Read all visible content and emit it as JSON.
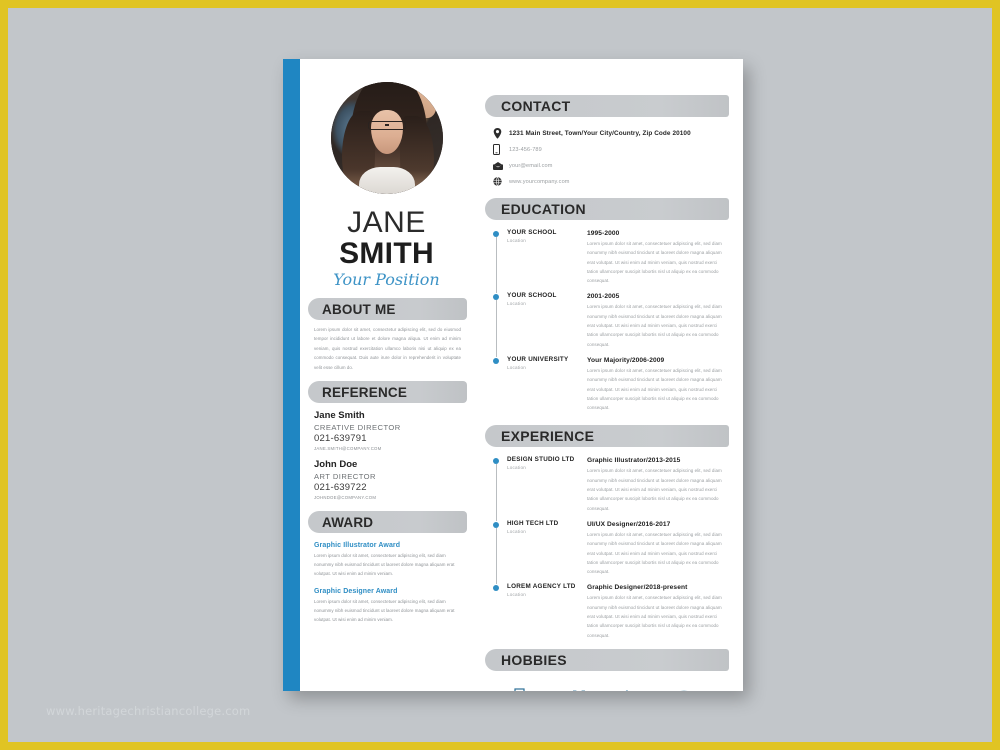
{
  "watermark": "www.heritagechristiancollege.com",
  "theme": {
    "accent": "#1f86c2",
    "bar": "#c5c8cb",
    "border": "#e0c423",
    "background": "#c2c6ca"
  },
  "profile": {
    "photo_alt": "portrait-photo",
    "first_name": "JANE",
    "last_name": "SMITH",
    "position": "Your Position"
  },
  "contact": {
    "heading": "CONTACT",
    "rows": [
      {
        "icon": "map-pin-icon",
        "text": "1231 Main Street, Town/Your City/Country, Zip Code 20100",
        "primary": true
      },
      {
        "icon": "phone-icon",
        "text": "123-456-789",
        "primary": false
      },
      {
        "icon": "envelope-icon",
        "text": "your@email.com",
        "primary": false
      },
      {
        "icon": "globe-icon",
        "text": "www.yourcompany.com",
        "primary": false
      }
    ]
  },
  "about": {
    "heading": "ABOUT ME",
    "text": "Lorem ipsum dolor sit amet, consectetur adipiscing elit, sed do eiusmod tempor incididunt ut labore et dolore magna aliqua. Ut enim ad minim veniam, quis nostrud exercitation ullamco laboris nisi ut aliquip ex ea commodo consequat. Duis aute irure dolor in reprehenderit in voluptate velit esse cillum do."
  },
  "reference": {
    "heading": "REFERENCE",
    "items": [
      {
        "name": "Jane Smith",
        "role": "CREATIVE DIRECTOR",
        "phone": "021-639791",
        "email": "JANE.SMITH@COMPANY.COM"
      },
      {
        "name": "John Doe",
        "role": "ART DIRECTOR",
        "phone": "021-639722",
        "email": "JOHNDOE@COMPANY.COM"
      }
    ]
  },
  "award": {
    "heading": "AWARD",
    "items": [
      {
        "title": "Graphic Illustrator Award",
        "desc": "Lorem ipsum dolor sit amet, consectetuer adipiscing elit, sed diam nonummy nibh euismod tincidunt ut laoreet dolore magna aliquam erat volutpat. Ut wisi enim ad minim veniam."
      },
      {
        "title": "Graphic Designer Award",
        "desc": "Lorem ipsum dolor sit amet, consectetuer adipiscing elit, sed diam nonummy nibh euismod tincidunt ut laoreet dolore magna aliquam erat volutpat. Ut wisi enim ad minim veniam."
      }
    ]
  },
  "education": {
    "heading": "EDUCATION",
    "items": [
      {
        "org": "YOUR SCHOOL",
        "location": "Location",
        "title": "1995-2000",
        "desc": "Lorem ipsum dolor sit amet, consectetuer adipiscing elit, sed diam nonummy nibh euismod tincidunt ut laoreet dolore magna aliquam erat volutpat. Ut wisi enim ad minim veniam, quis nostrud exerci tation ullamcorper suscipit lobortis nisl ut aliquip ex ea commodo consequat."
      },
      {
        "org": "YOUR SCHOOL",
        "location": "Location",
        "title": "2001-2005",
        "desc": "Lorem ipsum dolor sit amet, consectetuer adipiscing elit, sed diam nonummy nibh euismod tincidunt ut laoreet dolore magna aliquam erat volutpat. Ut wisi enim ad minim veniam, quis nostrud exerci tation ullamcorper suscipit lobortis nisl ut aliquip ex ea commodo consequat."
      },
      {
        "org": "YOUR UNIVERSITY",
        "location": "Location",
        "title": "Your Majority/2006-2009",
        "desc": "Lorem ipsum dolor sit amet, consectetuer adipiscing elit, sed diam nonummy nibh euismod tincidunt ut laoreet dolore magna aliquam erat volutpat. Ut wisi enim ad minim veniam, quis nostrud exerci tation ullamcorper suscipit lobortis nisl ut aliquip ex ea commodo consequat."
      }
    ]
  },
  "experience": {
    "heading": "EXPERIENCE",
    "items": [
      {
        "org": "DESIGN STUDIO LTD",
        "location": "Location",
        "title": "Graphic Illustrator/2013-2015",
        "desc": "Lorem ipsum dolor sit amet, consectetuer adipiscing elit, sed diam nonummy nibh euismod tincidunt ut laoreet dolore magna aliquam erat volutpat. Ut wisi enim ad minim veniam, quis nostrud exerci tation ullamcorper suscipit lobortis nisl ut aliquip ex ea commodo consequat."
      },
      {
        "org": "HIGH TECH LTD",
        "location": "Location",
        "title": "UI/UX Designer/2016-2017",
        "desc": "Lorem ipsum dolor sit amet, consectetuer adipiscing elit, sed diam nonummy nibh euismod tincidunt ut laoreet dolore magna aliquam erat volutpat. Ut wisi enim ad minim veniam, quis nostrud exerci tation ullamcorper suscipit lobortis nisl ut aliquip ex ea commodo consequat."
      },
      {
        "org": "LOREM AGENCY LTD",
        "location": "Location",
        "title": "Graphic Designer/2018-present",
        "desc": "Lorem ipsum dolor sit amet, consectetuer adipiscing elit, sed diam nonummy nibh euismod tincidunt ut laoreet dolore magna aliquam erat volutpat. Ut wisi enim ad minim veniam, quis nostrud exerci tation ullamcorper suscipit lobortis nisl ut aliquip ex ea commodo consequat."
      }
    ]
  },
  "hobbies": {
    "heading": "HOBBIES",
    "icons": [
      "camera-icon",
      "game-controller-icon",
      "music-note-icon",
      "football-icon"
    ]
  }
}
